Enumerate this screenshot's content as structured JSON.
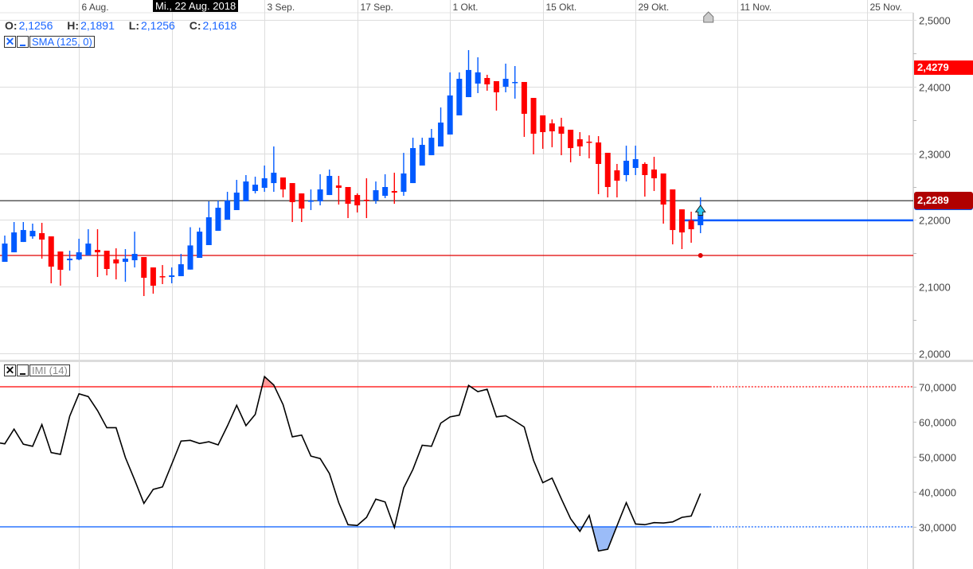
{
  "crosshair": {
    "date_label": "Mi., 22 Aug. 2018"
  },
  "ohlc_legend": {
    "open_label": "O:",
    "open": "2,1256",
    "high_label": "H:",
    "high": "2,1891",
    "low_label": "L:",
    "low": "2,1256",
    "close_label": "C:",
    "close": "2,1618"
  },
  "indicators": [
    {
      "name": "SMA (125, 0)",
      "close_icon": "close-x-icon",
      "minimize_icon": "minimize-icon"
    },
    {
      "name": "IMI (14)",
      "close_icon": "close-x-icon",
      "minimize_icon": "minimize-icon"
    }
  ],
  "price_tags": {
    "high_marker": {
      "value": "2,4279",
      "color": "#ff0000"
    },
    "last": {
      "value": "2,2289",
      "color": "#b00000"
    }
  },
  "colors": {
    "up": "#005aff",
    "down": "#ff0000",
    "imi_line": "#000000",
    "overbought": "#ff0000",
    "oversold": "#005aff",
    "overbought_fill": "#ff9c9c",
    "oversold_fill": "#9bbcf8",
    "grid": "#dddddd"
  },
  "chart_data": [
    {
      "type": "candlestick",
      "ylim": [
        2.0,
        2.5
      ],
      "y_ticks": [
        {
          "v": 2.5,
          "label": "2,5000"
        },
        {
          "v": 2.4,
          "label": "2,4000"
        },
        {
          "v": 2.3,
          "label": "2,3000"
        },
        {
          "v": 2.2,
          "label": "2,2000"
        },
        {
          "v": 2.1,
          "label": "2,1000"
        },
        {
          "v": 2.0,
          "label": "2,0000"
        }
      ],
      "x_ticks": [
        {
          "date": "2018-08-06",
          "label": "6 Aug."
        },
        {
          "date": "2018-08-20",
          "label": ""
        },
        {
          "date": "2018-09-03",
          "label": "3 Sep."
        },
        {
          "date": "2018-09-17",
          "label": "17 Sep."
        },
        {
          "date": "2018-10-01",
          "label": "1 Okt."
        },
        {
          "date": "2018-10-15",
          "label": "15 Okt."
        },
        {
          "date": "2018-10-29",
          "label": "29 Okt."
        },
        {
          "date": "2018-11-11",
          "label": "11 Nov."
        },
        {
          "date": "2018-11-25",
          "label": "25 Nov."
        }
      ],
      "grid": true,
      "horizontal_lines": [
        {
          "value": 2.2289,
          "color": "#222222"
        },
        {
          "value": 2.1468,
          "color": "#e00000"
        },
        {
          "value": 2.1994,
          "color": "#005aff",
          "from_date": "2018-11-05"
        }
      ],
      "candles_columns": [
        "date",
        "open",
        "high",
        "low",
        "close"
      ],
      "candles": [
        [
          "2018-07-25",
          2.1372,
          2.1766,
          2.1372,
          2.1646
        ],
        [
          "2018-07-26",
          2.1515,
          2.1969,
          2.1515,
          2.1813
        ],
        [
          "2018-07-27",
          2.167,
          2.1969,
          2.167,
          2.1849
        ],
        [
          "2018-07-30",
          2.1754,
          2.1945,
          2.1718,
          2.1837
        ],
        [
          "2018-07-31",
          2.1802,
          2.1957,
          2.142,
          2.1706
        ],
        [
          "2018-08-01",
          2.1754,
          2.1754,
          2.105,
          2.13
        ],
        [
          "2018-08-02",
          2.1527,
          2.1527,
          2.1014,
          2.1253
        ],
        [
          "2018-08-03",
          2.1396,
          2.1539,
          2.1241,
          2.142
        ],
        [
          "2018-08-06",
          2.1408,
          2.1718,
          2.1396,
          2.1515
        ],
        [
          "2018-08-07",
          2.1467,
          2.1861,
          2.1467,
          2.1646
        ],
        [
          "2018-08-08",
          2.1551,
          2.1861,
          2.1145,
          2.1515
        ],
        [
          "2018-08-09",
          2.1539,
          2.1539,
          2.1169,
          2.1265
        ],
        [
          "2018-08-10",
          2.1408,
          2.1575,
          2.1109,
          2.1348
        ],
        [
          "2018-08-13",
          2.1372,
          2.1563,
          2.1074,
          2.142
        ],
        [
          "2018-08-14",
          2.1396,
          2.1825,
          2.1288,
          2.1491
        ],
        [
          "2018-08-15",
          2.1444,
          2.1444,
          2.0859,
          2.1133
        ],
        [
          "2018-08-16",
          2.1288,
          2.1288,
          2.0895,
          2.1014
        ],
        [
          "2018-08-17",
          2.1157,
          2.1324,
          2.1038,
          2.1145
        ],
        [
          "2018-08-20",
          2.1145,
          2.1288,
          2.105,
          2.1169
        ],
        [
          "2018-08-21",
          2.1157,
          2.1491,
          2.1157,
          2.1336
        ],
        [
          "2018-08-22",
          2.1256,
          2.1891,
          2.1256,
          2.1618
        ],
        [
          "2018-08-23",
          2.1432,
          2.1885,
          2.1432,
          2.1825
        ],
        [
          "2018-08-24",
          2.1623,
          2.2279,
          2.1623,
          2.204
        ],
        [
          "2018-08-27",
          2.1837,
          2.2291,
          2.1837,
          2.2183
        ],
        [
          "2018-08-28",
          2.2004,
          2.2422,
          2.2004,
          2.2291
        ],
        [
          "2018-08-29",
          2.2148,
          2.2601,
          2.2148,
          2.241
        ],
        [
          "2018-08-30",
          2.2279,
          2.2673,
          2.2279,
          2.2577
        ],
        [
          "2018-08-31",
          2.2434,
          2.2649,
          2.2398,
          2.2529
        ],
        [
          "2018-09-03",
          2.2482,
          2.2816,
          2.2422,
          2.2625
        ],
        [
          "2018-09-04",
          2.2553,
          2.3102,
          2.2422,
          2.2708
        ],
        [
          "2018-09-05",
          2.2637,
          2.2637,
          2.2338,
          2.2458
        ],
        [
          "2018-09-06",
          2.2553,
          2.2553,
          2.1969,
          2.2267
        ],
        [
          "2018-09-07",
          2.2398,
          2.2398,
          2.1969,
          2.2171
        ],
        [
          "2018-09-10",
          2.2279,
          2.2458,
          2.2148,
          2.2291
        ],
        [
          "2018-09-11",
          2.2279,
          2.2685,
          2.2219,
          2.2458
        ],
        [
          "2018-09-12",
          2.2374,
          2.2756,
          2.2374,
          2.2661
        ],
        [
          "2018-09-13",
          2.2517,
          2.2661,
          2.2231,
          2.2482
        ],
        [
          "2018-09-14",
          2.2494,
          2.2494,
          2.2028,
          2.2243
        ],
        [
          "2018-09-17",
          2.2374,
          2.2398,
          2.2112,
          2.2219
        ],
        [
          "2018-09-18",
          2.2303,
          2.2625,
          2.2028,
          2.2291
        ],
        [
          "2018-09-19",
          2.2291,
          2.2577,
          2.2243,
          2.2446
        ],
        [
          "2018-09-20",
          2.2362,
          2.2685,
          2.2327,
          2.2494
        ],
        [
          "2018-09-21",
          2.2434,
          2.2708,
          2.2243,
          2.241
        ],
        [
          "2018-09-24",
          2.2422,
          2.3006,
          2.2362,
          2.2697
        ],
        [
          "2018-09-25",
          2.2553,
          2.3233,
          2.2553,
          2.3078
        ],
        [
          "2018-09-26",
          2.2816,
          2.3233,
          2.2816,
          2.3126
        ],
        [
          "2018-09-27",
          2.2971,
          2.3365,
          2.2971,
          2.3233
        ],
        [
          "2018-09-28",
          2.3102,
          2.3687,
          2.3102,
          2.346
        ],
        [
          "2018-10-01",
          2.3281,
          2.4213,
          2.3281,
          2.3867
        ],
        [
          "2018-10-02",
          2.3568,
          2.4213,
          2.3568,
          2.4117
        ],
        [
          "2018-10-03",
          2.3842,
          2.4547,
          2.3842,
          2.4249
        ],
        [
          "2018-10-04",
          2.4045,
          2.4439,
          2.3902,
          2.4213
        ],
        [
          "2018-10-05",
          2.4129,
          2.4177,
          2.3938,
          2.4033
        ],
        [
          "2018-10-08",
          2.4081,
          2.4081,
          2.364,
          2.3914
        ],
        [
          "2018-10-09",
          2.3998,
          2.4344,
          2.3914,
          2.4117
        ],
        [
          "2018-10-10",
          2.4065,
          2.4308,
          2.3819,
          2.4069
        ],
        [
          "2018-10-11",
          2.4069,
          2.4069,
          2.3246,
          2.3592
        ],
        [
          "2018-10-12",
          2.383,
          2.383,
          2.2984,
          2.3293
        ],
        [
          "2018-10-15",
          2.3568,
          2.3568,
          2.3067,
          2.3317
        ],
        [
          "2018-10-16",
          2.3448,
          2.3508,
          2.309,
          2.3329
        ],
        [
          "2018-10-17",
          2.3401,
          2.3532,
          2.2971,
          2.3293
        ],
        [
          "2018-10-18",
          2.3353,
          2.3353,
          2.2864,
          2.3078
        ],
        [
          "2018-10-19",
          2.321,
          2.3317,
          2.2959,
          2.3102
        ],
        [
          "2018-10-22",
          2.3174,
          2.3269,
          2.2924,
          2.3162
        ],
        [
          "2018-10-23",
          2.3162,
          2.3257,
          2.2387,
          2.284
        ],
        [
          "2018-10-24",
          2.3007,
          2.3007,
          2.2338,
          2.2494
        ],
        [
          "2018-10-25",
          2.2744,
          2.284,
          2.2338,
          2.2589
        ],
        [
          "2018-10-26",
          2.2673,
          2.3114,
          2.2577,
          2.2888
        ],
        [
          "2018-10-29",
          2.278,
          2.3114,
          2.2673,
          2.2912
        ],
        [
          "2018-10-30",
          2.284,
          2.2864,
          2.235,
          2.2673
        ],
        [
          "2018-10-31",
          2.2756,
          2.2947,
          2.2434,
          2.2625
        ],
        [
          "2018-11-01",
          2.2697,
          2.2697,
          2.1945,
          2.2231
        ],
        [
          "2018-11-02",
          2.2458,
          2.2458,
          2.1634,
          2.1849
        ],
        [
          "2018-11-05",
          2.2159,
          2.2159,
          2.1563,
          2.1813
        ],
        [
          "2018-11-06",
          2.1992,
          2.2124,
          2.1658,
          2.1861
        ],
        [
          "2018-11-07",
          2.1921,
          2.2339,
          2.1802,
          2.2064
        ]
      ]
    },
    {
      "type": "line",
      "ylim": [
        20,
        75
      ],
      "y_ticks": [
        {
          "v": 70,
          "label": "70,0000"
        },
        {
          "v": 60,
          "label": "60,0000"
        },
        {
          "v": 50,
          "label": "50,0000"
        },
        {
          "v": 40,
          "label": "40,0000"
        },
        {
          "v": 30,
          "label": "30,0000"
        }
      ],
      "overbought": 70,
      "oversold": 30,
      "values": [
        53.7,
        57.9,
        53.6,
        53.0,
        59.2,
        51.2,
        50.7,
        61.6,
        68.0,
        67.2,
        63.2,
        58.3,
        58.3,
        49.8,
        43.4,
        36.7,
        40.7,
        41.4,
        47.9,
        54.5,
        54.7,
        53.8,
        54.3,
        53.4,
        58.8,
        64.7,
        58.9,
        62.1,
        72.9,
        70.5,
        64.9,
        55.7,
        56.2,
        50.2,
        49.5,
        45.2,
        36.9,
        30.6,
        30.4,
        32.7,
        37.9,
        37.1,
        29.8,
        41.1,
        46.4,
        53.3,
        53.0,
        59.6,
        61.4,
        61.9,
        70.4,
        68.6,
        69.3,
        61.4,
        61.75,
        60.2,
        58.5,
        49.0,
        42.6,
        43.9,
        38.0,
        32.3,
        28.7,
        33.25,
        23.1,
        23.6,
        30.3,
        36.9,
        30.8,
        30.6,
        31.2,
        31.1,
        31.4,
        32.7,
        33.1,
        39.5
      ]
    }
  ]
}
